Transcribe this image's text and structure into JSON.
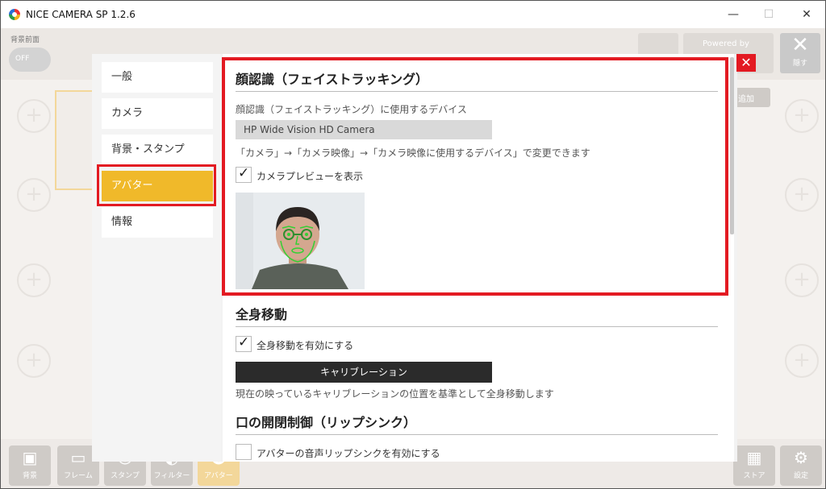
{
  "window": {
    "title": "NICE CAMERA SP 1.2.6",
    "minimize": "—",
    "maximize": "☐",
    "close": "✕"
  },
  "background_app": {
    "bg_front_label": "背景前面",
    "bg_toggle": "OFF",
    "powered_by": "Powered by",
    "hide_label": "隠す",
    "add_label": "追加",
    "bottom_buttons": [
      "背景",
      "フレーム",
      "スタンプ",
      "フィルター",
      "アバター",
      "ストア",
      "設定"
    ]
  },
  "nav": {
    "items": [
      {
        "label": "一般"
      },
      {
        "label": "カメラ"
      },
      {
        "label": "背景・スタンプ"
      },
      {
        "label": "アバター"
      },
      {
        "label": "情報"
      }
    ],
    "active_index": 3
  },
  "face": {
    "title": "顔認識（フェイストラッキング）",
    "device_label": "顔認識（フェイストラッキング）に使用するデバイス",
    "device_value": "HP Wide Vision HD Camera",
    "hint": "「カメラ」→「カメラ映像」→「カメラ映像に使用するデバイス」で変更できます",
    "preview_checkbox_label": "カメラプレビューを表示",
    "preview_checked": true
  },
  "body_move": {
    "title": "全身移動",
    "enable_label": "全身移動を有効にする",
    "enabled": true,
    "calibration_button": "キャリブレーション",
    "calibration_hint": "現在の映っているキャリブレーションの位置を基準として全身移動します"
  },
  "lip_sync": {
    "title": "口の開閉制御（リップシンク）",
    "enable_label": "アバターの音声リップシンクを有効にする",
    "enabled": false
  },
  "colors": {
    "accent": "#f0b92a",
    "highlight": "#e31a22"
  }
}
